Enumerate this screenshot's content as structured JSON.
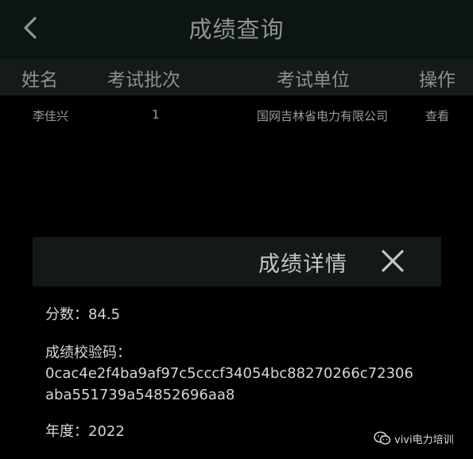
{
  "header": {
    "title": "成绩查询"
  },
  "table": {
    "columns": [
      "姓名",
      "考试批次",
      "考试单位",
      "操作"
    ],
    "rows": [
      {
        "name": "李佳兴",
        "batch": "1",
        "unit": "国网吉林省电力有限公司",
        "action": "查看"
      }
    ]
  },
  "dialog": {
    "title": "成绩详情",
    "score_label": "分数：",
    "score_value": "84.5",
    "code_label": "成绩校验码：",
    "code_line1": "0cac4e2f4ba9af97c5cccf34054bc88270266c72306",
    "code_line2": "aba551739a54852696aa8",
    "year_label": "年度：",
    "year_value": "2022"
  },
  "watermark": {
    "text": "vivi电力培训",
    "icon": "wechat-icon"
  },
  "colors": {
    "background": "#000000",
    "app_bar": "#0d1514",
    "table_header": "#151a1a",
    "dialog_header": "#121918"
  }
}
